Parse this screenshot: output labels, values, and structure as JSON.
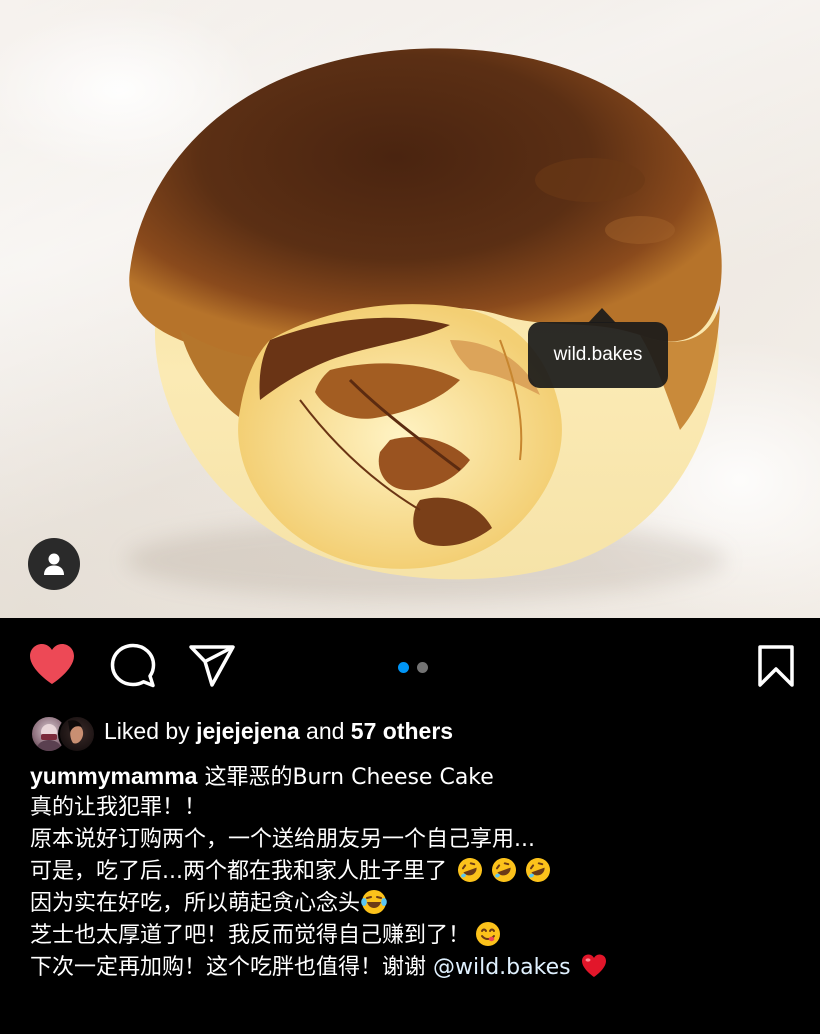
{
  "post": {
    "tag": {
      "label": "wild.bakes"
    },
    "likes": {
      "prefix": "Liked by",
      "user": "jejejejena",
      "connector": "and",
      "others": "57 others"
    },
    "caption": {
      "username": "yummymamma",
      "title": "这罪恶的Burn Cheese Cake",
      "lines": [
        "真的让我犯罪！！",
        "原本说好订购两个，一个送给朋友另一个自己享用...",
        "可是，吃了后...两个都在我和家人肚子里了",
        "因为实在好吃，所以萌起贪心念头",
        "芝士也太厚道了吧！我反而觉得自己赚到了！",
        "下次一定再加购！这个吃胖也值得！谢谢 "
      ],
      "mention": "@wild.bakes"
    },
    "carousel": {
      "count": 2,
      "active": 1
    }
  },
  "icons": {
    "like": "heart-icon",
    "comment": "comment-icon",
    "share": "send-icon",
    "save": "bookmark-icon",
    "user_tags": "person-icon",
    "emoji_rofl": "rolling-laughing-emoji",
    "emoji_joy": "tears-of-joy-emoji",
    "emoji_yum": "yum-emoji",
    "emoji_heart": "red-heart-emoji"
  },
  "colors": {
    "background": "#000000",
    "like_active": "#ed4956",
    "dot_active": "#0095f6",
    "dot_inactive": "#737373",
    "mention": "#e0f1ff"
  }
}
